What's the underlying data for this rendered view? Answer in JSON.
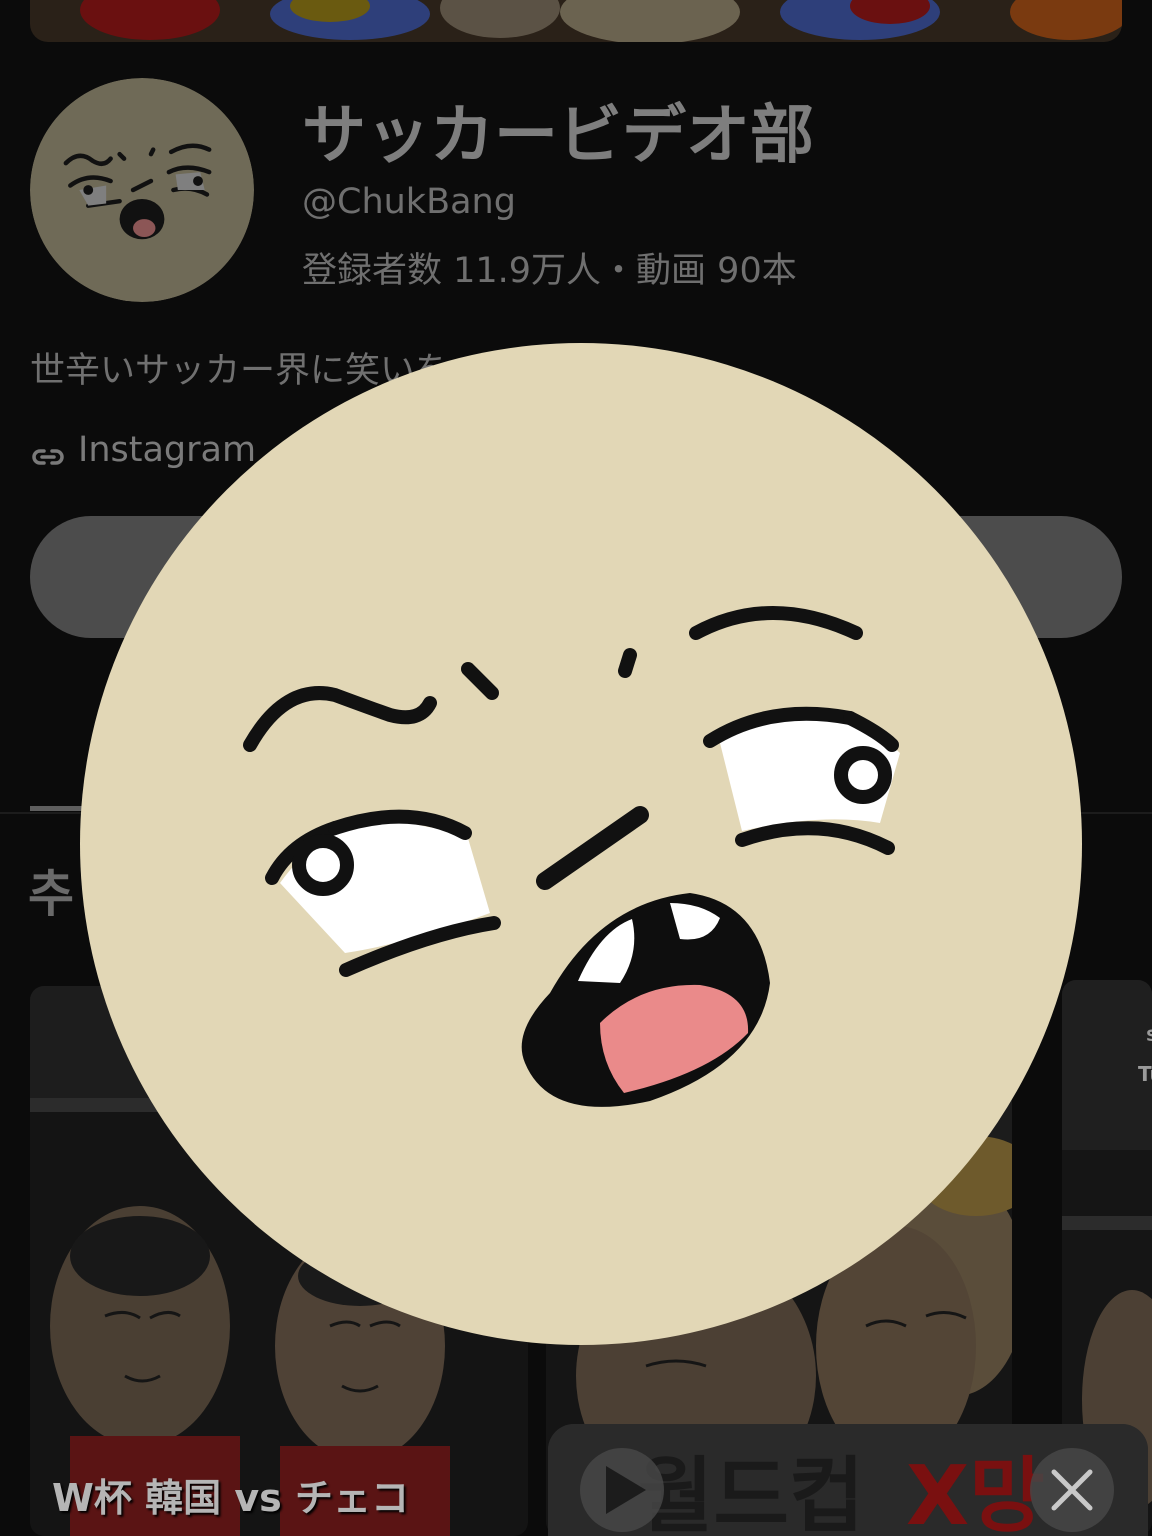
{
  "channel": {
    "name": "サッカービデオ部",
    "handle": "@ChukBang",
    "stats": "登録者数 11.9万人・動画 90本",
    "description": "世辛いサッカー界に笑いを",
    "link_label": "Instagram"
  },
  "section": {
    "heading_visible": "추"
  },
  "videos": [
    {
      "title": "W杯 韓国 vs チェコ"
    },
    {
      "title": ""
    },
    {
      "side_label_1": "S",
      "side_label_2": "Tu"
    }
  ],
  "mini_player": {
    "thumb_text_1": "월드컵",
    "thumb_text_2": "X망"
  },
  "colors": {
    "background": "#0b0b0b",
    "face_skin": "#e2d7b6",
    "tongue": "#ea8a8a",
    "button_dim": "#4c4c4c"
  },
  "icons": [
    "link-icon",
    "play-icon",
    "close-icon",
    "cartoon-face-icon"
  ]
}
